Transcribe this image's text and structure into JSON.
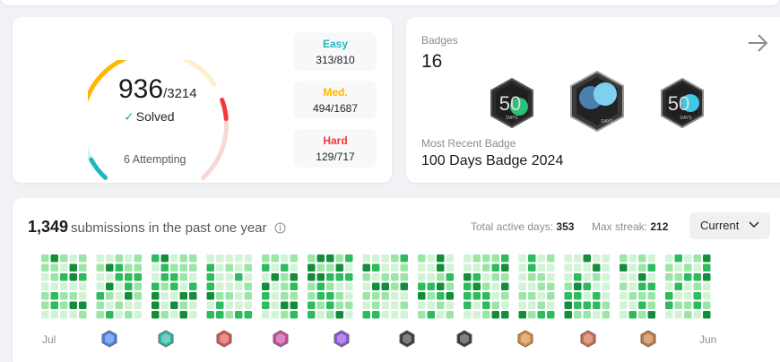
{
  "progress": {
    "solved": "936",
    "total": "/3214",
    "solved_label": "Solved",
    "attempting": "6 Attempting",
    "difficulties": [
      {
        "label": "Easy",
        "value": "313/810",
        "color": "#1cbaba"
      },
      {
        "label": "Med.",
        "value": "494/1687",
        "color": "#ffb700"
      },
      {
        "label": "Hard",
        "value": "129/717",
        "color": "#f63737"
      }
    ],
    "fractions": {
      "easy": 0.386,
      "medium": 0.293,
      "hard": 0.18
    }
  },
  "badges": {
    "title": "Badges",
    "count": "16",
    "recent_label": "Most Recent Badge",
    "recent_name": "100 Days Badge 2024",
    "items": [
      {
        "icon": "50-days-badge-icon",
        "number": "50",
        "sub": "DAYS",
        "accent": "#2cc07a"
      },
      {
        "icon": "100-days-badge-icon",
        "number": "",
        "sub": "DAYS",
        "accent": "#4cb3e6"
      },
      {
        "icon": "50-days-blue-badge-icon",
        "number": "50",
        "sub": "DAYS",
        "accent": "#3fc7e6"
      }
    ]
  },
  "heatmap": {
    "count": "1,349",
    "title_rest": "submissions in the past one year",
    "active_days_label": "Total active days:",
    "active_days": "353",
    "max_streak_label": "Max streak:",
    "max_streak": "212",
    "dropdown": "Current",
    "months": [
      "Jul",
      "Jun"
    ],
    "mini_badges": [
      "#4a7fe8",
      "#2cb7a3",
      "#d9534f",
      "#c94ba0",
      "#8c52d9",
      "#3b3b3b",
      "#3b3b3b",
      "#d88a3b",
      "#cc6a4c",
      "#c47a3a"
    ],
    "colors": [
      "#d2f3d6",
      "#9be6a6",
      "#2cbb5d",
      "#138d3a"
    ]
  }
}
